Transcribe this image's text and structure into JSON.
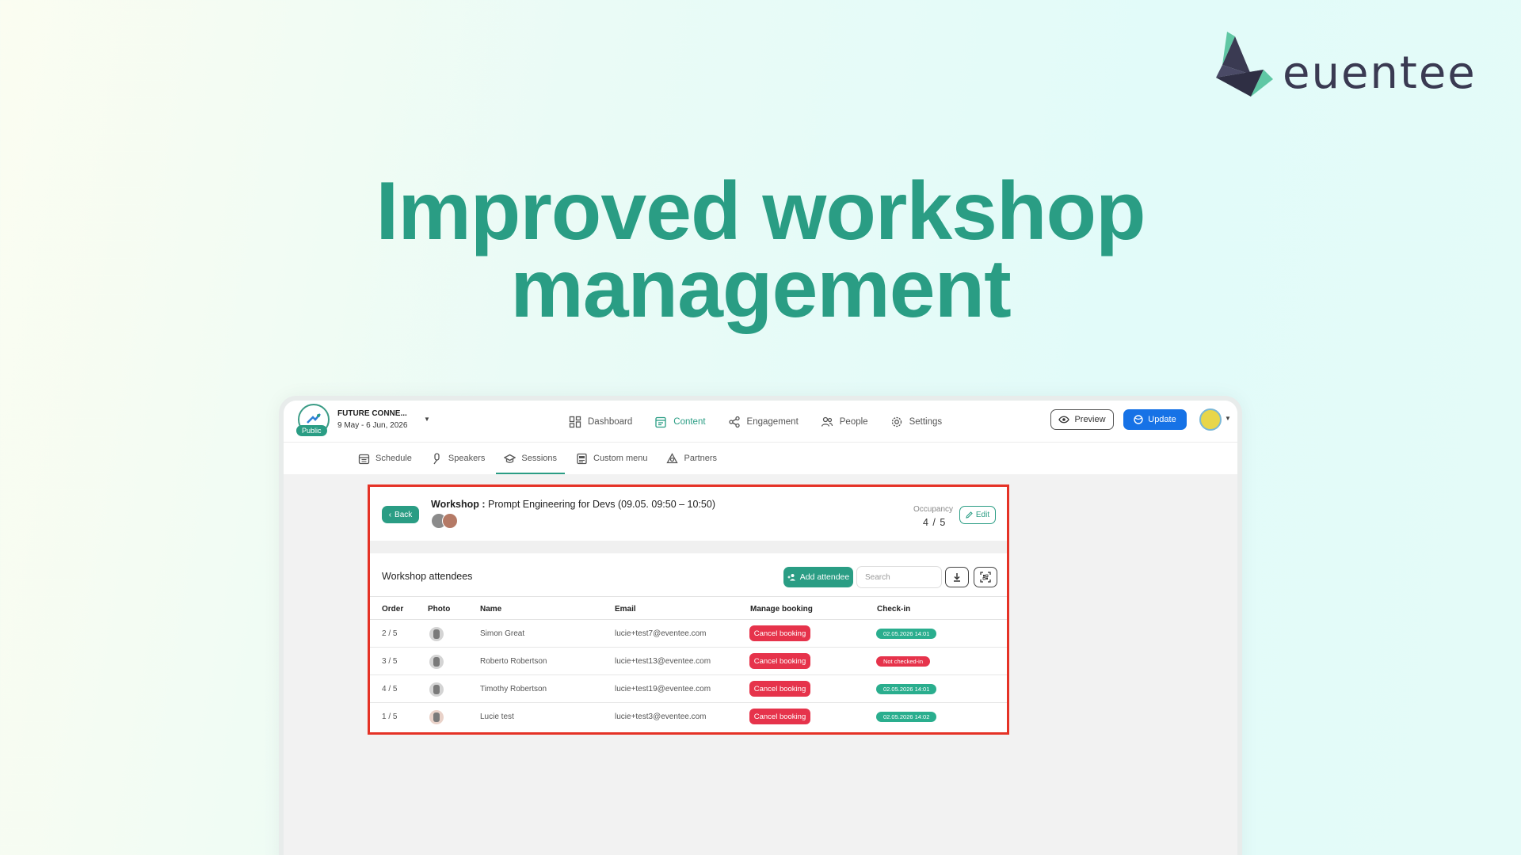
{
  "brand": {
    "logo_text": "euentee",
    "colors": {
      "primary": "#2a9d84",
      "logo_dark": "#3a3a52",
      "danger": "#e6334b",
      "update_blue": "#1672e6",
      "highlight_red": "#e53226"
    }
  },
  "headline": {
    "line1": "Improved workshop",
    "line2": "management"
  },
  "topbar": {
    "event_name": "FUTURE CONNE...",
    "event_dates": "9 May - 6 Jun, 2026",
    "event_status": "Public",
    "nav": [
      {
        "label": "Dashboard",
        "icon": "dashboard-icon",
        "active": false
      },
      {
        "label": "Content",
        "icon": "content-icon",
        "active": true
      },
      {
        "label": "Engagement",
        "icon": "share-icon",
        "active": false
      },
      {
        "label": "People",
        "icon": "people-icon",
        "active": false
      },
      {
        "label": "Settings",
        "icon": "gear-icon",
        "active": false
      }
    ],
    "preview_label": "Preview",
    "update_label": "Update"
  },
  "subnav": [
    {
      "label": "Schedule",
      "icon": "calendar-icon",
      "active": false
    },
    {
      "label": "Speakers",
      "icon": "microphone-icon",
      "active": false
    },
    {
      "label": "Sessions",
      "icon": "graduation-cap-icon",
      "active": true
    },
    {
      "label": "Custom menu",
      "icon": "document-icon",
      "active": false
    },
    {
      "label": "Partners",
      "icon": "partners-icon",
      "active": false
    }
  ],
  "workshop": {
    "back_label": "Back",
    "title_label": "Workshop :",
    "title_value": "Prompt Engineering for Devs (09.05. 09:50 – 10:50)",
    "occupancy_label": "Occupancy",
    "occupancy_value": "4 / 5",
    "edit_label": "Edit"
  },
  "attendees": {
    "title": "Workshop attendees",
    "add_label": "Add attendee",
    "search_placeholder": "Search",
    "columns": [
      "Order",
      "Photo",
      "Name",
      "Email",
      "Manage booking",
      "Check-in"
    ],
    "rows": [
      {
        "order": "2 / 5",
        "name": "Simon Great",
        "email": "lucie+test7@eventee.com",
        "action": "Cancel booking",
        "checkin": "02.05.2026 14:01",
        "checked": true
      },
      {
        "order": "3 / 5",
        "name": "Roberto Robertson",
        "email": "lucie+test13@eventee.com",
        "action": "Cancel booking",
        "checkin": "Not checked-in",
        "checked": false
      },
      {
        "order": "4 / 5",
        "name": "Timothy Robertson",
        "email": "lucie+test19@eventee.com",
        "action": "Cancel booking",
        "checkin": "02.05.2026 14:01",
        "checked": true
      },
      {
        "order": "1 / 5",
        "name": "Lucie test",
        "email": "lucie+test3@eventee.com",
        "action": "Cancel booking",
        "checkin": "02.05.2026 14:02",
        "checked": true
      }
    ]
  }
}
